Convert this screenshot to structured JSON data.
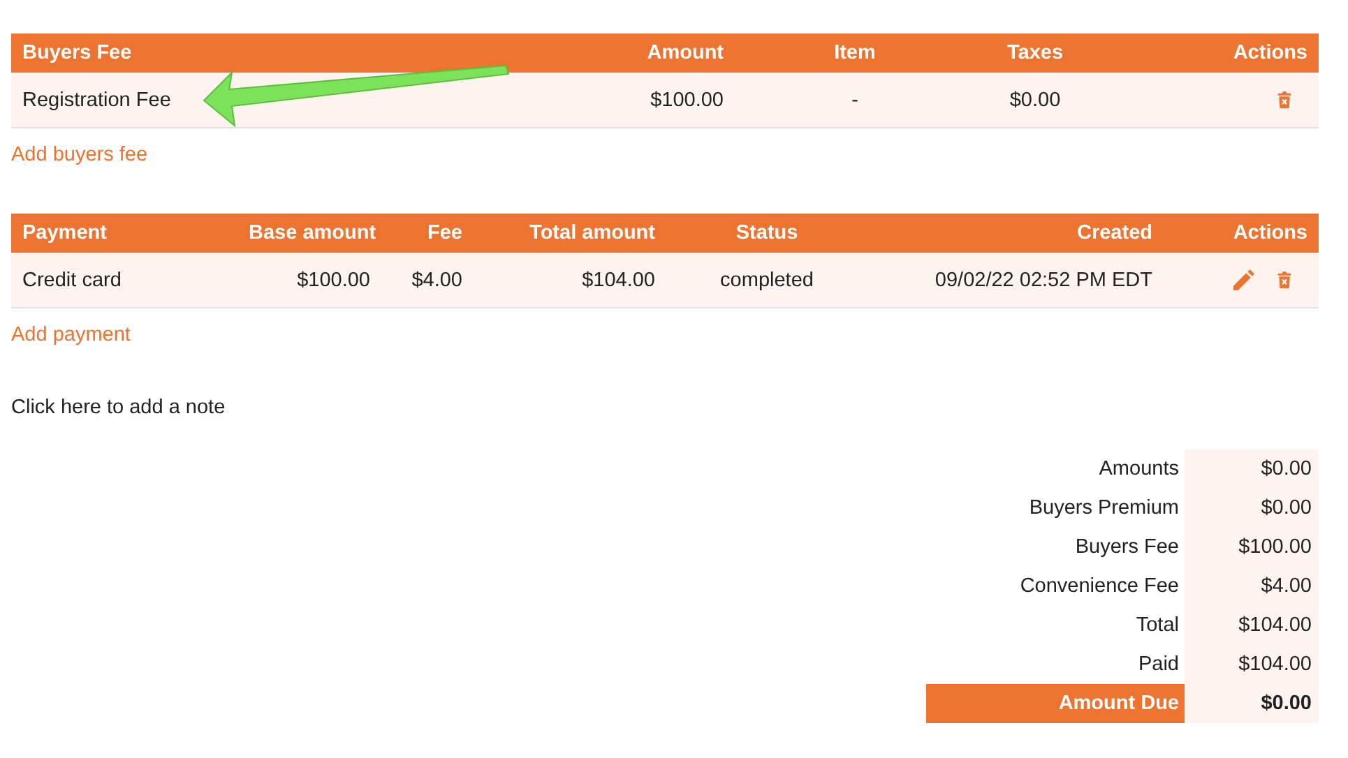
{
  "buyers_fee_table": {
    "columns": [
      "Buyers Fee",
      "Amount",
      "Item",
      "Taxes",
      "Actions"
    ],
    "rows": [
      {
        "cells": [
          "Registration Fee",
          "$100.00",
          "-",
          "$0.00"
        ],
        "actions": [
          {
            "kind": "delete"
          }
        ]
      }
    ]
  },
  "add_buyers_fee_link": "Add buyers fee",
  "payments_table": {
    "columns": [
      "Payment",
      "Base amount",
      "Fee",
      "Total amount",
      "Status",
      "Created",
      "Actions"
    ],
    "rows": [
      {
        "cells": [
          "Credit card",
          "$100.00",
          "$4.00",
          "$104.00",
          "completed",
          "09/02/22 02:52 PM EDT"
        ],
        "actions": [
          {
            "kind": "edit"
          },
          {
            "kind": "delete"
          }
        ]
      }
    ]
  },
  "add_payment_link": "Add payment",
  "note_prompt": "Click here to add a note",
  "summary": [
    {
      "label": "Amounts",
      "value": "$0.00",
      "kind": "line"
    },
    {
      "label": "Buyers Premium",
      "value": "$0.00",
      "kind": "line"
    },
    {
      "label": "Buyers Fee",
      "value": "$100.00",
      "kind": "line"
    },
    {
      "label": "Convenience Fee",
      "value": "$4.00",
      "kind": "line"
    },
    {
      "label": "Total",
      "value": "$104.00",
      "kind": "line"
    },
    {
      "label": "Paid",
      "value": "$104.00",
      "kind": "line"
    },
    {
      "label": "Amount Due",
      "value": "$0.00",
      "kind": "due"
    }
  ]
}
